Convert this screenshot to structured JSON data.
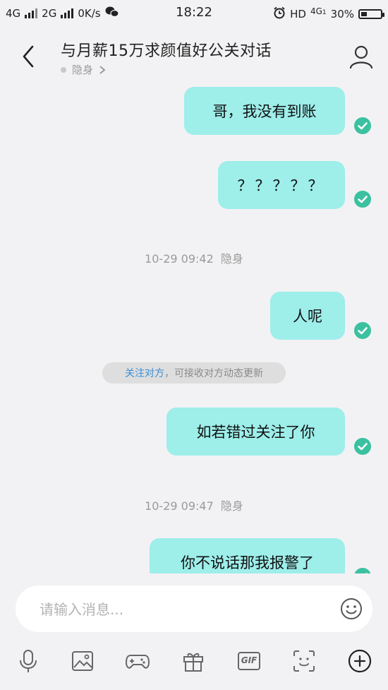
{
  "status": {
    "net1": "4G",
    "net2": "2G",
    "speed": "0K/s",
    "time": "18:22",
    "hd": "HD",
    "net3": "4G",
    "net3_sub": "1",
    "battery": "30%",
    "battery_level": 0.3
  },
  "header": {
    "title": "与月薪15万求颜值好公关对话",
    "status": "隐身"
  },
  "messages": [
    {
      "text": "哥，我没有到账"
    },
    {
      "text": "？？？？？"
    },
    {
      "text": "人呢"
    },
    {
      "text": "如若错过关注了你"
    },
    {
      "text": "你不说话那我报警了"
    }
  ],
  "timestamps": [
    {
      "time": "10-29 09:42",
      "status": "隐身"
    },
    {
      "time": "10-29 09:47",
      "status": "隐身"
    }
  ],
  "notice": {
    "link": "关注对方",
    "rest": "，可接收对方动态更新"
  },
  "composer": {
    "placeholder": "请输入消息..."
  },
  "toolbar": {
    "gif": "GIF"
  },
  "colors": {
    "bubble": "#9eeeea",
    "check": "#3bc1a0",
    "link": "#3b8fd8"
  }
}
